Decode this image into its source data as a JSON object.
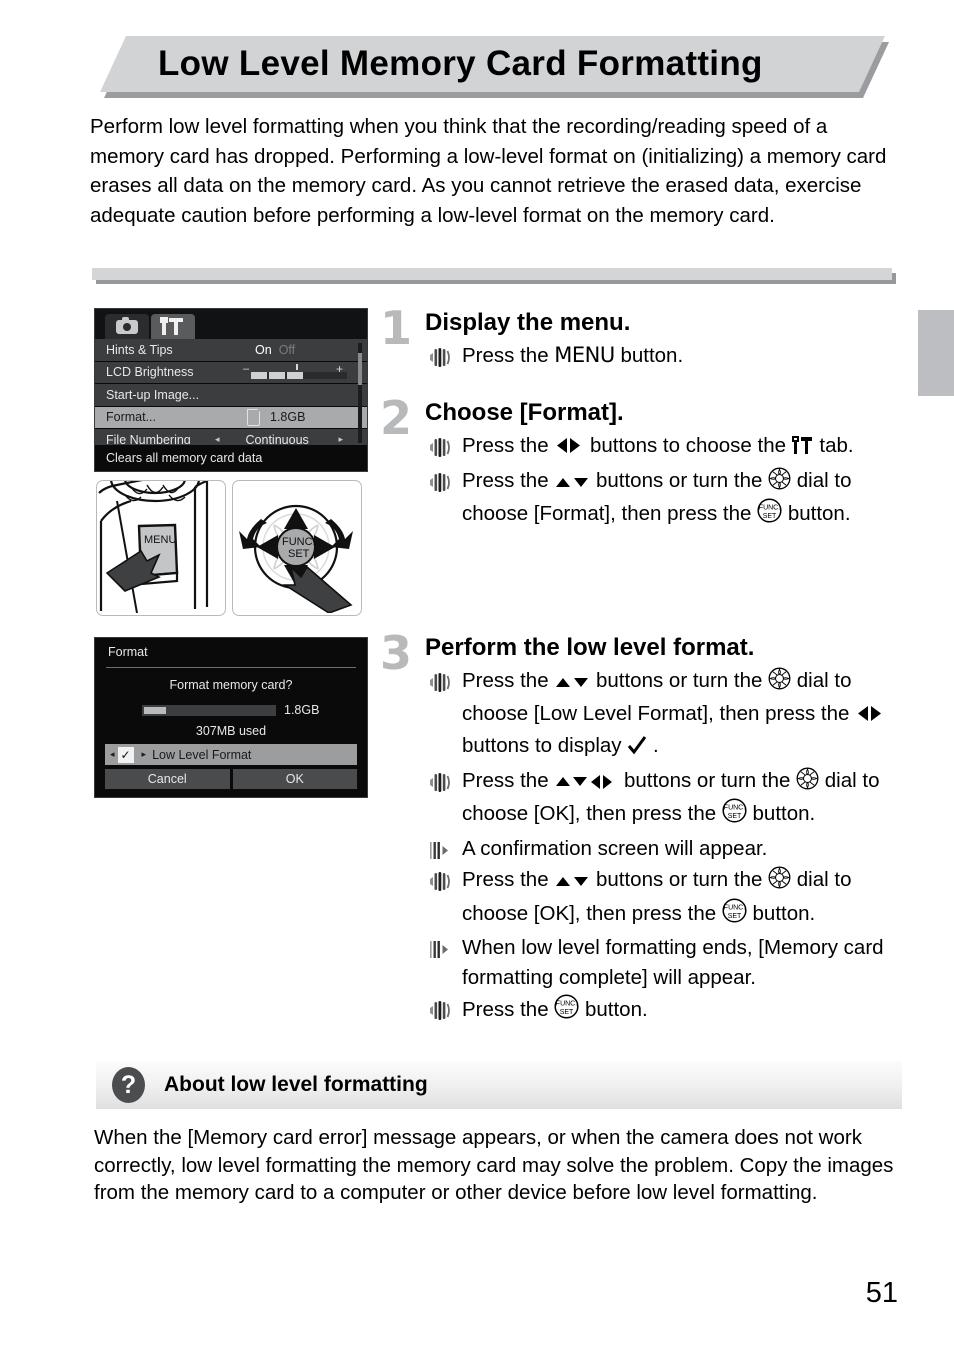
{
  "page": {
    "title": "Low Level Memory Card Formatting",
    "number": "51",
    "intro": "Perform low level formatting when you think that the recording/reading speed of a memory card has dropped. Performing a low-level format on (initializing) a memory card erases all data on the memory card. As you cannot retrieve the erased data, exercise adequate caution before performing a low-level format on the memory card."
  },
  "lcd_menu": {
    "tabs": [
      {
        "icon": "camera-icon",
        "active": false
      },
      {
        "icon": "tools-icon",
        "active": true
      }
    ],
    "rows": [
      {
        "label": "Hints & Tips",
        "value_on": "On",
        "value_off": "Off"
      },
      {
        "label": "LCD Brightness",
        "minus": "–",
        "plus": "+"
      },
      {
        "label": "Start-up Image...",
        "value": ""
      },
      {
        "label": "Format...",
        "value": "1.8GB",
        "selected": true
      },
      {
        "label": "File Numbering",
        "value": "Continuous",
        "arrow_left": "◂",
        "arrow_right": "▸"
      }
    ],
    "hint": "Clears all memory card data"
  },
  "illustrations": {
    "menu_button_label": "MENU",
    "func_set_line1": "FUNC.",
    "func_set_line2": "SET"
  },
  "lcd_dialog": {
    "title": "Format",
    "question": "Format memory card?",
    "size": "1.8GB",
    "used": "307MB used",
    "low_level_label": "Low Level Format",
    "check_glyph": "✓",
    "arrow_left": "◂",
    "arrow_right": "▸",
    "cancel": "Cancel",
    "ok": "OK"
  },
  "steps": [
    {
      "number": "1",
      "heading": "Display the menu.",
      "lines": [
        {
          "bullet": "speaker",
          "parts": [
            {
              "t": "text",
              "v": "Press the "
            },
            {
              "t": "menu-word",
              "v": "MENU"
            },
            {
              "t": "text",
              "v": " button."
            }
          ]
        }
      ]
    },
    {
      "number": "2",
      "heading": "Choose [Format].",
      "lines": [
        {
          "bullet": "speaker",
          "parts": [
            {
              "t": "text",
              "v": "Press the "
            },
            {
              "t": "icon",
              "v": "left-right-arrows-icon"
            },
            {
              "t": "text",
              "v": " buttons to choose the "
            },
            {
              "t": "icon",
              "v": "tools-tab-icon"
            },
            {
              "t": "text",
              "v": " tab."
            }
          ]
        },
        {
          "bullet": "speaker",
          "parts": [
            {
              "t": "text",
              "v": "Press the "
            },
            {
              "t": "icon",
              "v": "up-down-arrows-icon"
            },
            {
              "t": "text",
              "v": " buttons or turn the "
            },
            {
              "t": "icon",
              "v": "control-dial-icon"
            },
            {
              "t": "text",
              "v": " dial to choose [Format], then press the "
            },
            {
              "t": "icon",
              "v": "func-set-icon"
            },
            {
              "t": "text",
              "v": " button."
            }
          ]
        }
      ]
    },
    {
      "number": "3",
      "heading": "Perform the low level format.",
      "lines": [
        {
          "bullet": "speaker",
          "parts": [
            {
              "t": "text",
              "v": "Press the "
            },
            {
              "t": "icon",
              "v": "up-down-arrows-icon"
            },
            {
              "t": "text",
              "v": " buttons or turn the "
            },
            {
              "t": "icon",
              "v": "control-dial-icon"
            },
            {
              "t": "text",
              "v": " dial to choose [Low Level Format], then press the "
            },
            {
              "t": "icon",
              "v": "left-right-arrows-icon"
            },
            {
              "t": "text",
              "v": " buttons to display "
            },
            {
              "t": "icon",
              "v": "checkmark-icon"
            },
            {
              "t": "text",
              "v": " ."
            }
          ]
        },
        {
          "bullet": "speaker",
          "parts": [
            {
              "t": "text",
              "v": "Press the "
            },
            {
              "t": "icon",
              "v": "up-down-left-right-arrows-icon"
            },
            {
              "t": "text",
              "v": " buttons or turn the "
            },
            {
              "t": "icon",
              "v": "control-dial-icon"
            },
            {
              "t": "text",
              "v": " dial to choose [OK], then press the "
            },
            {
              "t": "icon",
              "v": "func-set-icon"
            },
            {
              "t": "text",
              "v": " button."
            }
          ]
        },
        {
          "bullet": "result",
          "parts": [
            {
              "t": "text",
              "v": "A confirmation screen will appear."
            }
          ]
        },
        {
          "bullet": "speaker",
          "parts": [
            {
              "t": "text",
              "v": "Press the "
            },
            {
              "t": "icon",
              "v": "up-down-arrows-icon"
            },
            {
              "t": "text",
              "v": " buttons or turn the "
            },
            {
              "t": "icon",
              "v": "control-dial-icon"
            },
            {
              "t": "text",
              "v": " dial to choose [OK], then press the "
            },
            {
              "t": "icon",
              "v": "func-set-icon"
            },
            {
              "t": "text",
              "v": " button."
            }
          ]
        },
        {
          "bullet": "result",
          "parts": [
            {
              "t": "text",
              "v": "When low level formatting ends, [Memory card formatting complete] will appear."
            }
          ]
        },
        {
          "bullet": "speaker",
          "parts": [
            {
              "t": "text",
              "v": "Press the "
            },
            {
              "t": "icon",
              "v": "func-set-icon"
            },
            {
              "t": "text",
              "v": " button."
            }
          ]
        }
      ]
    }
  ],
  "info_panel": {
    "badge": "?",
    "title": "About low level formatting",
    "body": "When the [Memory card error] message appears, or when the camera does not work correctly, low level formatting the memory card may solve the problem. Copy the images from the memory card to a computer or other device before low level formatting."
  },
  "colors": {
    "header_bg": "#d2d3d5",
    "header_shadow": "#9a9ca0",
    "step_number": "#b8b9bb",
    "edge_tab": "#bcbec1",
    "lcd_bg": "#0a0a0a",
    "lcd_row": "#3c3d3f",
    "lcd_row_selected": "#a9aaac"
  }
}
